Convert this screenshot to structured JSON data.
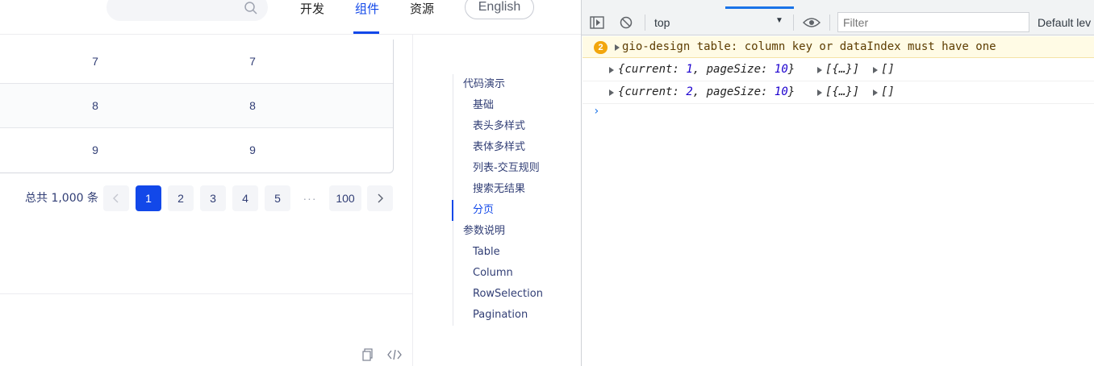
{
  "header": {
    "nav": [
      "开发",
      "组件",
      "资源"
    ],
    "active_nav": "组件",
    "language_button": "English"
  },
  "table": {
    "rows": [
      {
        "col1": "7",
        "col2": "7"
      },
      {
        "col1": "8",
        "col2": "8"
      },
      {
        "col1": "9",
        "col2": "9"
      }
    ]
  },
  "pagination": {
    "total_label": "总共 1,000 条",
    "pages": [
      "1",
      "2",
      "3",
      "4",
      "5"
    ],
    "ellipsis": "···",
    "last_page": "100",
    "current": "1"
  },
  "toc": {
    "sections": [
      {
        "label": "代码演示",
        "items": [
          "基础",
          "表头多样式",
          "表体多样式",
          "列表-交互规则",
          "搜索无结果",
          "分页"
        ]
      },
      {
        "label": "参数说明",
        "items": [
          "Table",
          "Column",
          "RowSelection",
          "Pagination"
        ]
      }
    ],
    "active_item": "分页"
  },
  "devtools": {
    "context": "top",
    "filter_placeholder": "Filter",
    "levels_label": "Default lev",
    "warning": {
      "count": "2",
      "message": "gio-design table: column key or dataIndex must have one"
    },
    "logs": [
      {
        "current": "1",
        "pageSize": "10",
        "array1": "[{…}]",
        "array2": "[]"
      },
      {
        "current": "2",
        "pageSize": "10",
        "array1": "[{…}]",
        "array2": "[]"
      }
    ],
    "prompt": "›"
  },
  "colors": {
    "brand": "#1248e9",
    "devtools_accent": "#1a73e8",
    "warning_bg": "#fffbe5",
    "warning_badge": "#f2a60c"
  },
  "icons": [
    "search-icon",
    "chevron-left-icon",
    "chevron-right-icon",
    "copy-icon",
    "code-icon",
    "sidebar-toggle-icon",
    "clear-console-icon",
    "eye-icon"
  ]
}
